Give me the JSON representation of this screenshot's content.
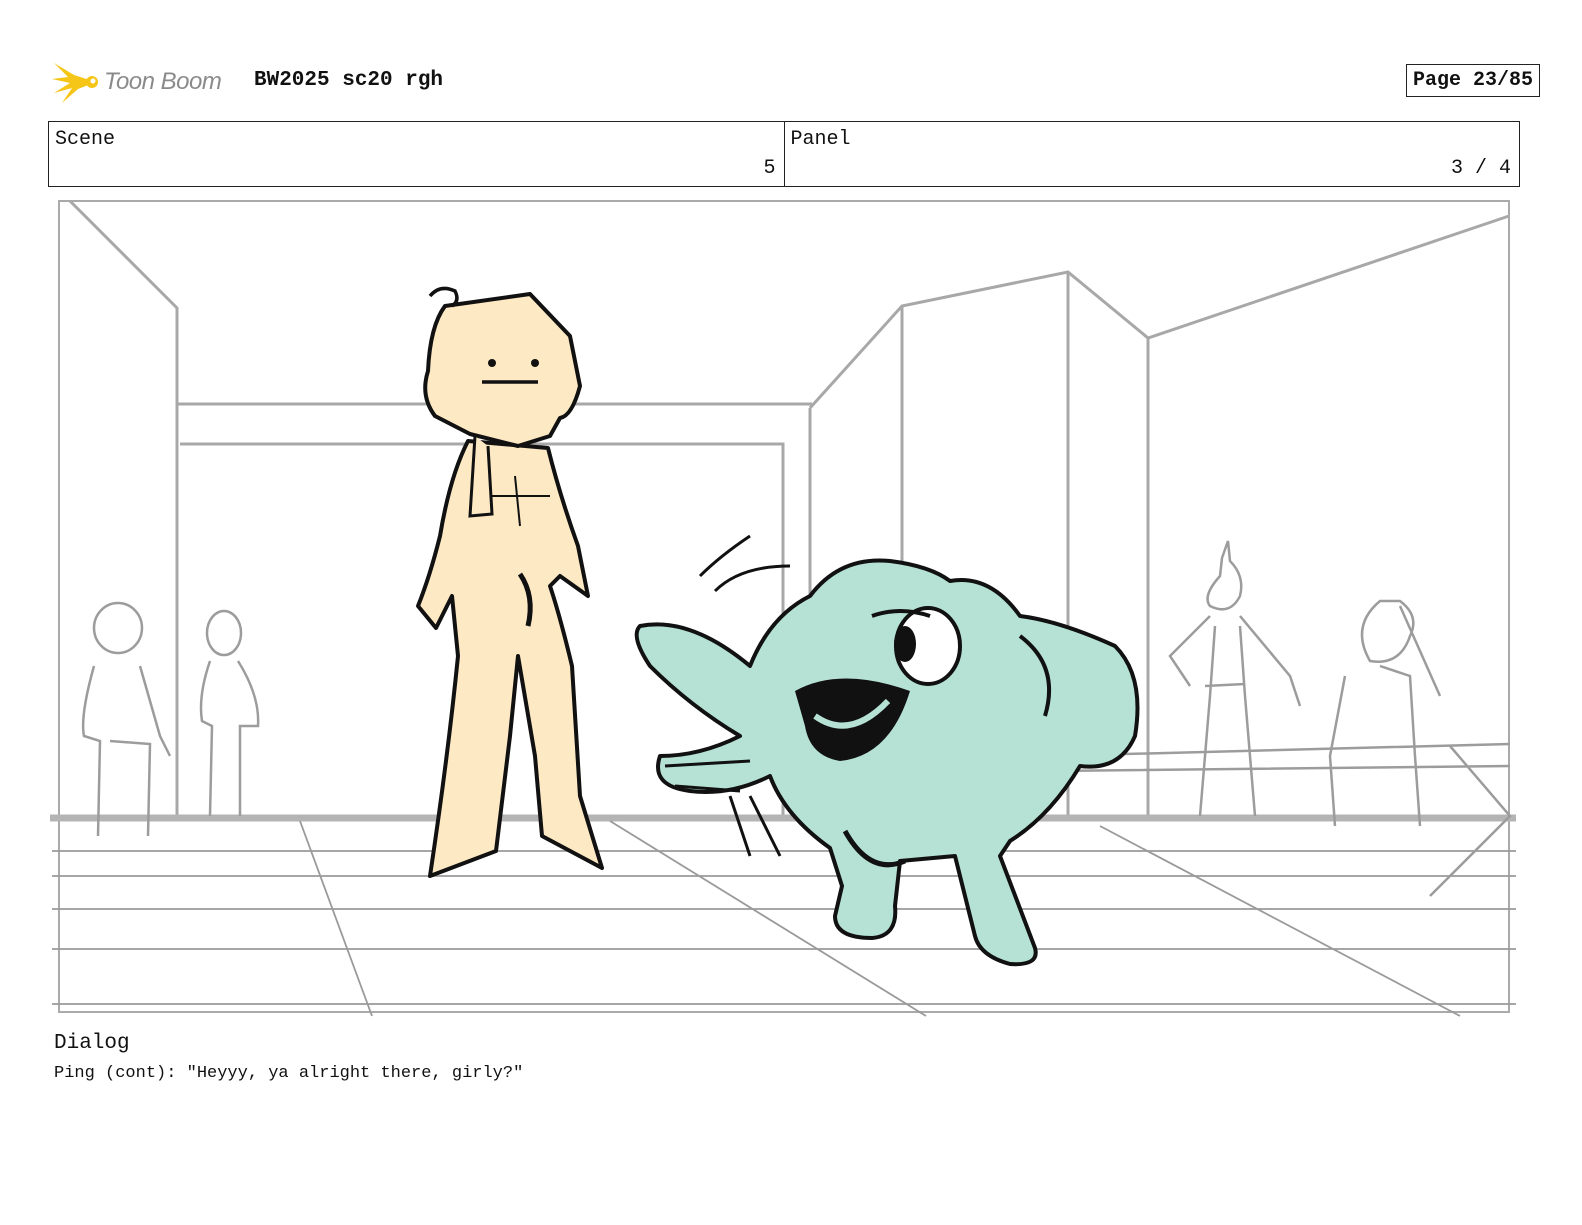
{
  "header": {
    "logo_text": "Toon Boom",
    "logo_icon": "starburst-icon",
    "doc_title": "BW2025 sc20 rgh",
    "page_label": "Page 23/85"
  },
  "info": {
    "scene_label": "Scene",
    "scene_value": "5",
    "panel_label": "Panel",
    "panel_value": "3 / 4"
  },
  "dialog": {
    "label": "Dialog",
    "text": "Ping (cont): \"Heyyy, ya alright there, girly?\""
  },
  "colors": {
    "logo_yellow": "#f5c518",
    "girl_fill": "#fde9c4",
    "creature_fill": "#b5e2d4",
    "background_lines": "#9e9e9e",
    "ink": "#111111"
  }
}
